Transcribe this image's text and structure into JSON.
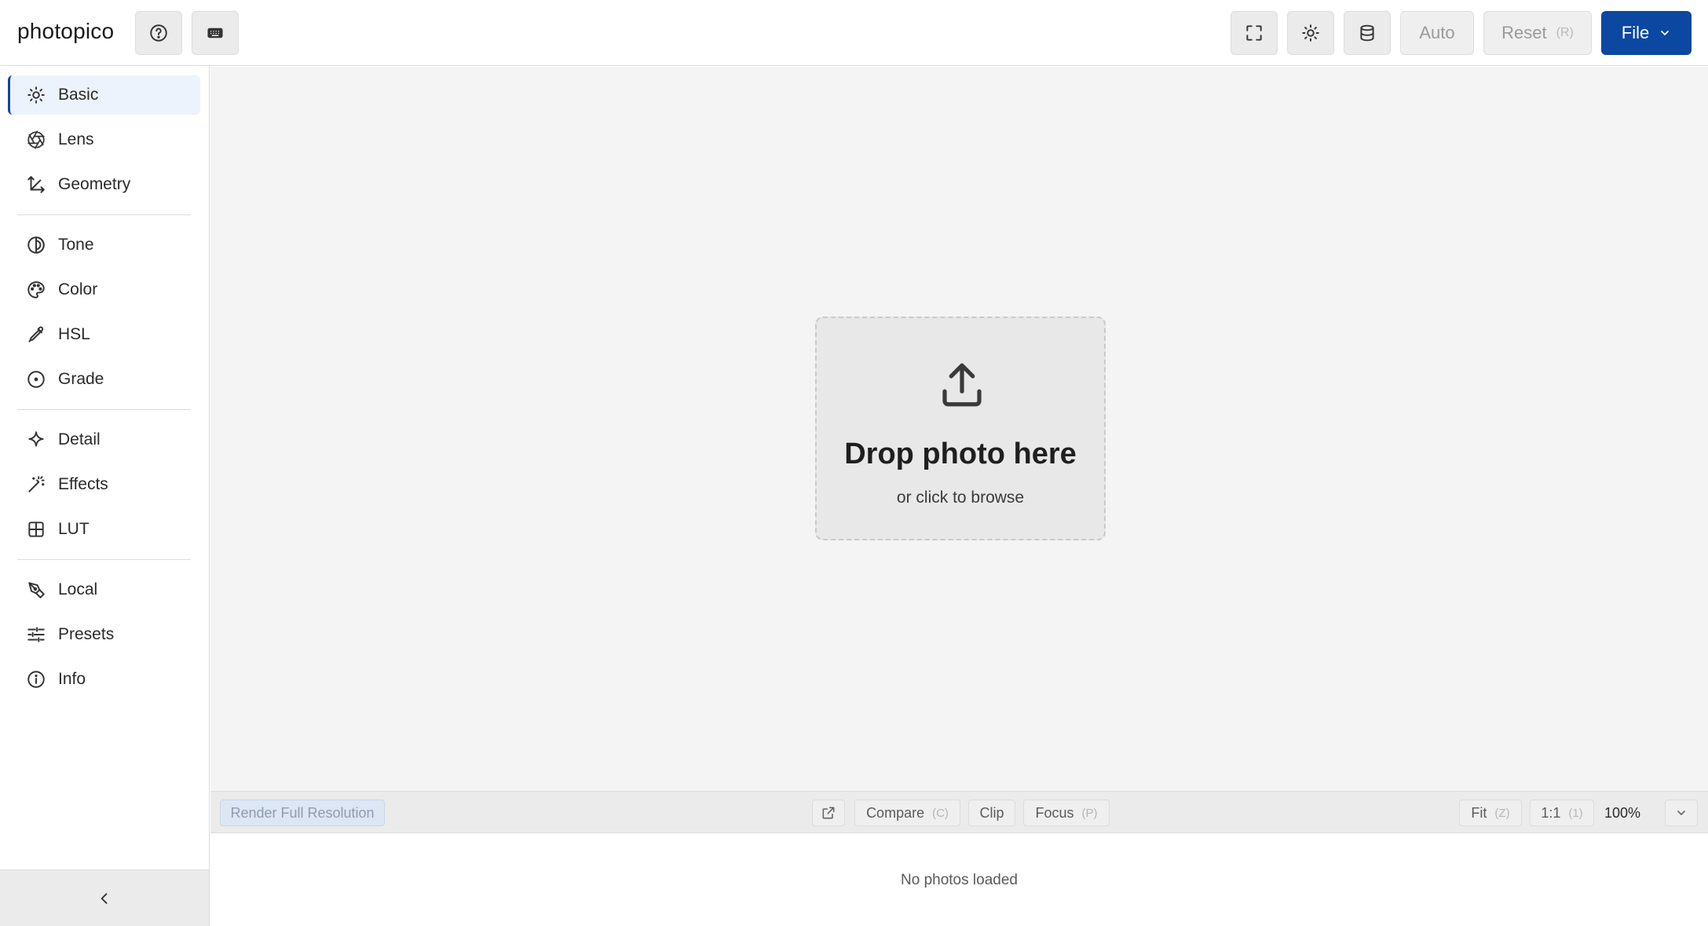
{
  "app": {
    "title": "photopico"
  },
  "header": {
    "auto_label": "Auto",
    "reset_label": "Reset",
    "reset_key": "(R)",
    "file_label": "File"
  },
  "sidebar": {
    "items": [
      {
        "label": "Basic",
        "icon": "sun-icon",
        "active": true
      },
      {
        "label": "Lens",
        "icon": "aperture-icon"
      },
      {
        "label": "Geometry",
        "icon": "axes-icon"
      },
      {
        "label": "Tone",
        "icon": "half-circle-icon"
      },
      {
        "label": "Color",
        "icon": "palette-icon"
      },
      {
        "label": "HSL",
        "icon": "eyedropper-icon"
      },
      {
        "label": "Grade",
        "icon": "target-icon"
      },
      {
        "label": "Detail",
        "icon": "sparkle-icon"
      },
      {
        "label": "Effects",
        "icon": "magic-wand-icon"
      },
      {
        "label": "LUT",
        "icon": "grid-icon"
      },
      {
        "label": "Local",
        "icon": "pen-tool-icon"
      },
      {
        "label": "Presets",
        "icon": "sliders-icon"
      },
      {
        "label": "Info",
        "icon": "info-icon"
      }
    ]
  },
  "canvas": {
    "drop_title": "Drop photo here",
    "drop_subtitle": "or click to browse"
  },
  "toolbar": {
    "render_label": "Render Full Resolution",
    "compare_label": "Compare",
    "compare_key": "(C)",
    "clip_label": "Clip",
    "focus_label": "Focus",
    "focus_key": "(P)",
    "fit_label": "Fit",
    "fit_key": "(Z)",
    "one_label": "1:1",
    "one_key": "(1)",
    "zoom_value": "100%"
  },
  "filmstrip": {
    "empty_text": "No photos loaded"
  },
  "colors": {
    "accent": "#0c47a1",
    "active_bg": "#edf3fc",
    "canvas_bg": "#f4f4f4"
  }
}
